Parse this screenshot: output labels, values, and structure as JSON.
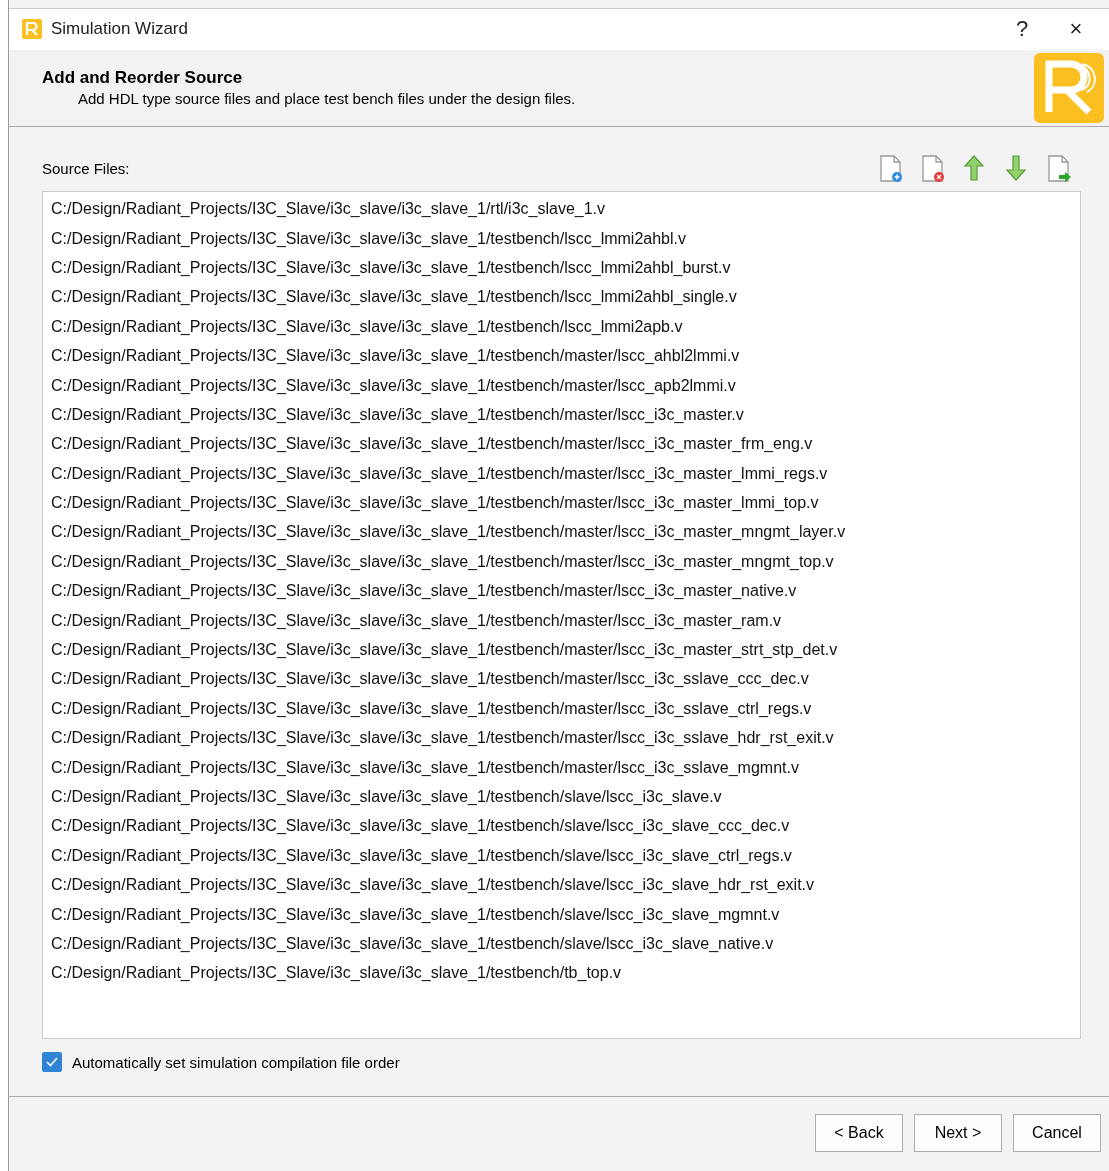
{
  "window": {
    "title": "Simulation Wizard",
    "help": "?",
    "close": "×"
  },
  "header": {
    "title": "Add and Reorder Source",
    "subtitle": "Add HDL type source files and place test bench files under the design files."
  },
  "source_files": {
    "label": "Source Files:",
    "toolbar": [
      {
        "kind": "add"
      },
      {
        "kind": "remove"
      },
      {
        "kind": "up"
      },
      {
        "kind": "down"
      },
      {
        "kind": "export"
      }
    ],
    "files": [
      "C:/Design/Radiant_Projects/I3C_Slave/i3c_slave/i3c_slave_1/rtl/i3c_slave_1.v",
      "C:/Design/Radiant_Projects/I3C_Slave/i3c_slave/i3c_slave_1/testbench/lscc_lmmi2ahbl.v",
      "C:/Design/Radiant_Projects/I3C_Slave/i3c_slave/i3c_slave_1/testbench/lscc_lmmi2ahbl_burst.v",
      "C:/Design/Radiant_Projects/I3C_Slave/i3c_slave/i3c_slave_1/testbench/lscc_lmmi2ahbl_single.v",
      "C:/Design/Radiant_Projects/I3C_Slave/i3c_slave/i3c_slave_1/testbench/lscc_lmmi2apb.v",
      "C:/Design/Radiant_Projects/I3C_Slave/i3c_slave/i3c_slave_1/testbench/master/lscc_ahbl2lmmi.v",
      "C:/Design/Radiant_Projects/I3C_Slave/i3c_slave/i3c_slave_1/testbench/master/lscc_apb2lmmi.v",
      "C:/Design/Radiant_Projects/I3C_Slave/i3c_slave/i3c_slave_1/testbench/master/lscc_i3c_master.v",
      "C:/Design/Radiant_Projects/I3C_Slave/i3c_slave/i3c_slave_1/testbench/master/lscc_i3c_master_frm_eng.v",
      "C:/Design/Radiant_Projects/I3C_Slave/i3c_slave/i3c_slave_1/testbench/master/lscc_i3c_master_lmmi_regs.v",
      "C:/Design/Radiant_Projects/I3C_Slave/i3c_slave/i3c_slave_1/testbench/master/lscc_i3c_master_lmmi_top.v",
      "C:/Design/Radiant_Projects/I3C_Slave/i3c_slave/i3c_slave_1/testbench/master/lscc_i3c_master_mngmt_layer.v",
      "C:/Design/Radiant_Projects/I3C_Slave/i3c_slave/i3c_slave_1/testbench/master/lscc_i3c_master_mngmt_top.v",
      "C:/Design/Radiant_Projects/I3C_Slave/i3c_slave/i3c_slave_1/testbench/master/lscc_i3c_master_native.v",
      "C:/Design/Radiant_Projects/I3C_Slave/i3c_slave/i3c_slave_1/testbench/master/lscc_i3c_master_ram.v",
      "C:/Design/Radiant_Projects/I3C_Slave/i3c_slave/i3c_slave_1/testbench/master/lscc_i3c_master_strt_stp_det.v",
      "C:/Design/Radiant_Projects/I3C_Slave/i3c_slave/i3c_slave_1/testbench/master/lscc_i3c_sslave_ccc_dec.v",
      "C:/Design/Radiant_Projects/I3C_Slave/i3c_slave/i3c_slave_1/testbench/master/lscc_i3c_sslave_ctrl_regs.v",
      "C:/Design/Radiant_Projects/I3C_Slave/i3c_slave/i3c_slave_1/testbench/master/lscc_i3c_sslave_hdr_rst_exit.v",
      "C:/Design/Radiant_Projects/I3C_Slave/i3c_slave/i3c_slave_1/testbench/master/lscc_i3c_sslave_mgmnt.v",
      "C:/Design/Radiant_Projects/I3C_Slave/i3c_slave/i3c_slave_1/testbench/slave/lscc_i3c_slave.v",
      "C:/Design/Radiant_Projects/I3C_Slave/i3c_slave/i3c_slave_1/testbench/slave/lscc_i3c_slave_ccc_dec.v",
      "C:/Design/Radiant_Projects/I3C_Slave/i3c_slave/i3c_slave_1/testbench/slave/lscc_i3c_slave_ctrl_regs.v",
      "C:/Design/Radiant_Projects/I3C_Slave/i3c_slave/i3c_slave_1/testbench/slave/lscc_i3c_slave_hdr_rst_exit.v",
      "C:/Design/Radiant_Projects/I3C_Slave/i3c_slave/i3c_slave_1/testbench/slave/lscc_i3c_slave_mgmnt.v",
      "C:/Design/Radiant_Projects/I3C_Slave/i3c_slave/i3c_slave_1/testbench/slave/lscc_i3c_slave_native.v",
      "C:/Design/Radiant_Projects/I3C_Slave/i3c_slave/i3c_slave_1/testbench/tb_top.v"
    ]
  },
  "auto_order": {
    "label": "Automatically set simulation compilation file order",
    "checked": true
  },
  "buttons": [
    "< Back",
    "Next >",
    "Cancel"
  ]
}
